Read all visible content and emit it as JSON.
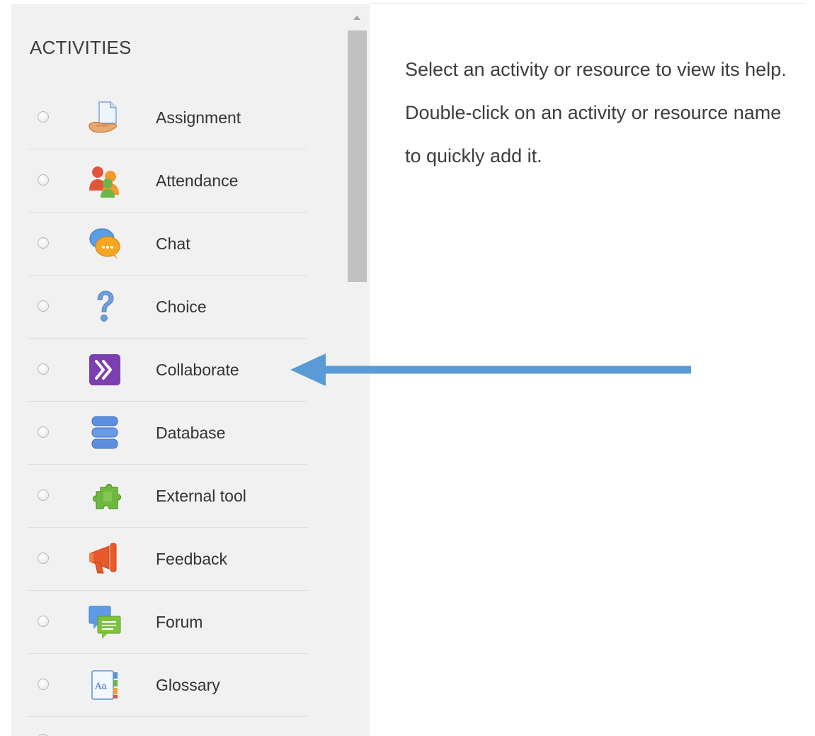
{
  "activities": {
    "heading": "ACTIVITIES",
    "items": [
      {
        "label": "Assignment",
        "icon": "assignment-icon"
      },
      {
        "label": "Attendance",
        "icon": "attendance-icon"
      },
      {
        "label": "Chat",
        "icon": "chat-icon"
      },
      {
        "label": "Choice",
        "icon": "choice-icon"
      },
      {
        "label": "Collaborate",
        "icon": "collaborate-icon"
      },
      {
        "label": "Database",
        "icon": "database-icon"
      },
      {
        "label": "External tool",
        "icon": "external-tool-icon"
      },
      {
        "label": "Feedback",
        "icon": "feedback-icon"
      },
      {
        "label": "Forum",
        "icon": "forum-icon"
      },
      {
        "label": "Glossary",
        "icon": "glossary-icon"
      }
    ]
  },
  "help": {
    "text": "Select an activity or resource to view its help. Double-click on an activity or resource name to quickly add it."
  },
  "annotation": {
    "arrow_color": "#5b9bd5",
    "points_to": "Collaborate"
  },
  "colors": {
    "panel_background": "#f1f1f1",
    "scroll_thumb": "#c1c1c1",
    "text": "#333333"
  }
}
